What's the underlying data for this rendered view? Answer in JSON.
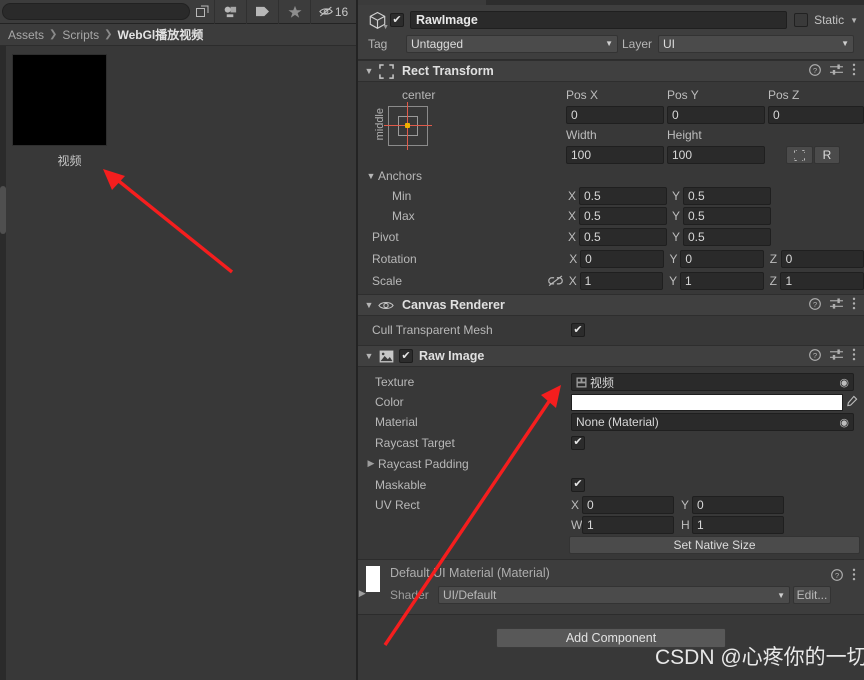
{
  "project_panel": {
    "toolbar": {
      "search_placeholder": "",
      "search_value": "",
      "expand_icon": "expand-search-icon",
      "buttons": [
        {
          "name": "favorites-filter-icon",
          "label": ""
        },
        {
          "name": "label-filter-icon",
          "label": ""
        },
        {
          "name": "star-filter-icon",
          "label": ""
        }
      ],
      "hidden_count": "16",
      "hidden_icon": "eye-off-icon"
    },
    "breadcrumb": [
      "Assets",
      "Scripts",
      "WebGl播放视频"
    ],
    "breadcrumb_separator": "❯",
    "assets": [
      {
        "name": "视频",
        "thumb_color": "#000000"
      }
    ]
  },
  "inspector": {
    "gameobject": {
      "icon": "gameobject-cube-icon",
      "enabled": true,
      "name": "RawImage",
      "static_checked": false,
      "static_label": "Static",
      "tag_label": "Tag",
      "tag_value": "Untagged",
      "layer_label": "Layer",
      "layer_value": "UI"
    },
    "components": [
      {
        "id": "rect-transform",
        "title": "Rect Transform",
        "icon": "rect-transform-icon",
        "expanded": true,
        "anchor_preset": {
          "horizontal": "center",
          "vertical": "middle"
        },
        "fields": {
          "pos_x_label": "Pos X",
          "pos_x": "0",
          "pos_y_label": "Pos Y",
          "pos_y": "0",
          "pos_z_label": "Pos Z",
          "pos_z": "0",
          "width_label": "Width",
          "width": "100",
          "height_label": "Height",
          "height": "100",
          "blueprint_icon": "blueprint-mode-icon",
          "raw_label": "R"
        },
        "anchors": {
          "title": "Anchors",
          "min_label": "Min",
          "min_x": "0.5",
          "min_y": "0.5",
          "max_label": "Max",
          "max_x": "0.5",
          "max_y": "0.5",
          "pivot_label": "Pivot",
          "pivot_x": "0.5",
          "pivot_y": "0.5"
        },
        "rotation": {
          "label": "Rotation",
          "x": "0",
          "y": "0",
          "z": "0"
        },
        "scale": {
          "label": "Scale",
          "x": "1",
          "y": "1",
          "z": "1",
          "link_icon": "link-off-icon"
        }
      },
      {
        "id": "canvas-renderer",
        "title": "Canvas Renderer",
        "icon": "eye-icon",
        "expanded": true,
        "cull_label": "Cull Transparent Mesh",
        "cull_checked": true
      },
      {
        "id": "raw-image",
        "title": "Raw Image",
        "icon": "image-icon",
        "expanded": true,
        "enabled": true,
        "texture_label": "Texture",
        "texture_value": "视频",
        "texture_icon": "texture-asset-icon",
        "color_label": "Color",
        "color_value": "#FFFFFF",
        "eyedropper_icon": "eyedropper-icon",
        "material_label": "Material",
        "material_value": "None (Material)",
        "raycast_target_label": "Raycast Target",
        "raycast_target_checked": true,
        "raycast_padding_label": "Raycast Padding",
        "maskable_label": "Maskable",
        "maskable_checked": true,
        "uv_rect_label": "UV Rect",
        "uv_x_axis": "X",
        "uv_x": "0",
        "uv_y_axis": "Y",
        "uv_y": "0",
        "uv_w_axis": "W",
        "uv_w": "1",
        "uv_h_axis": "H",
        "uv_h": "1",
        "set_native_size_label": "Set Native Size"
      }
    ],
    "material_preview": {
      "title": "Default UI Material (Material)",
      "swatch_color": "#FFFFFF",
      "shader_label": "Shader",
      "shader_value": "UI/Default",
      "edit_label": "Edit...",
      "foldout_icon": "foldout-collapsed-icon"
    },
    "add_component_label": "Add Component",
    "help_icon": "help-icon",
    "preset_icon": "preset-icon",
    "menu_icon": "kebab-menu-icon"
  },
  "watermark": "CSDN @心疼你的一切",
  "colors": {
    "panel_bg": "#383838",
    "header_bg": "#404040",
    "field_bg": "#2a2a2a",
    "arrow_red": "#f51e1e",
    "anchor_red": "#e05a4a",
    "anchor_pivot": "#f0b000"
  }
}
